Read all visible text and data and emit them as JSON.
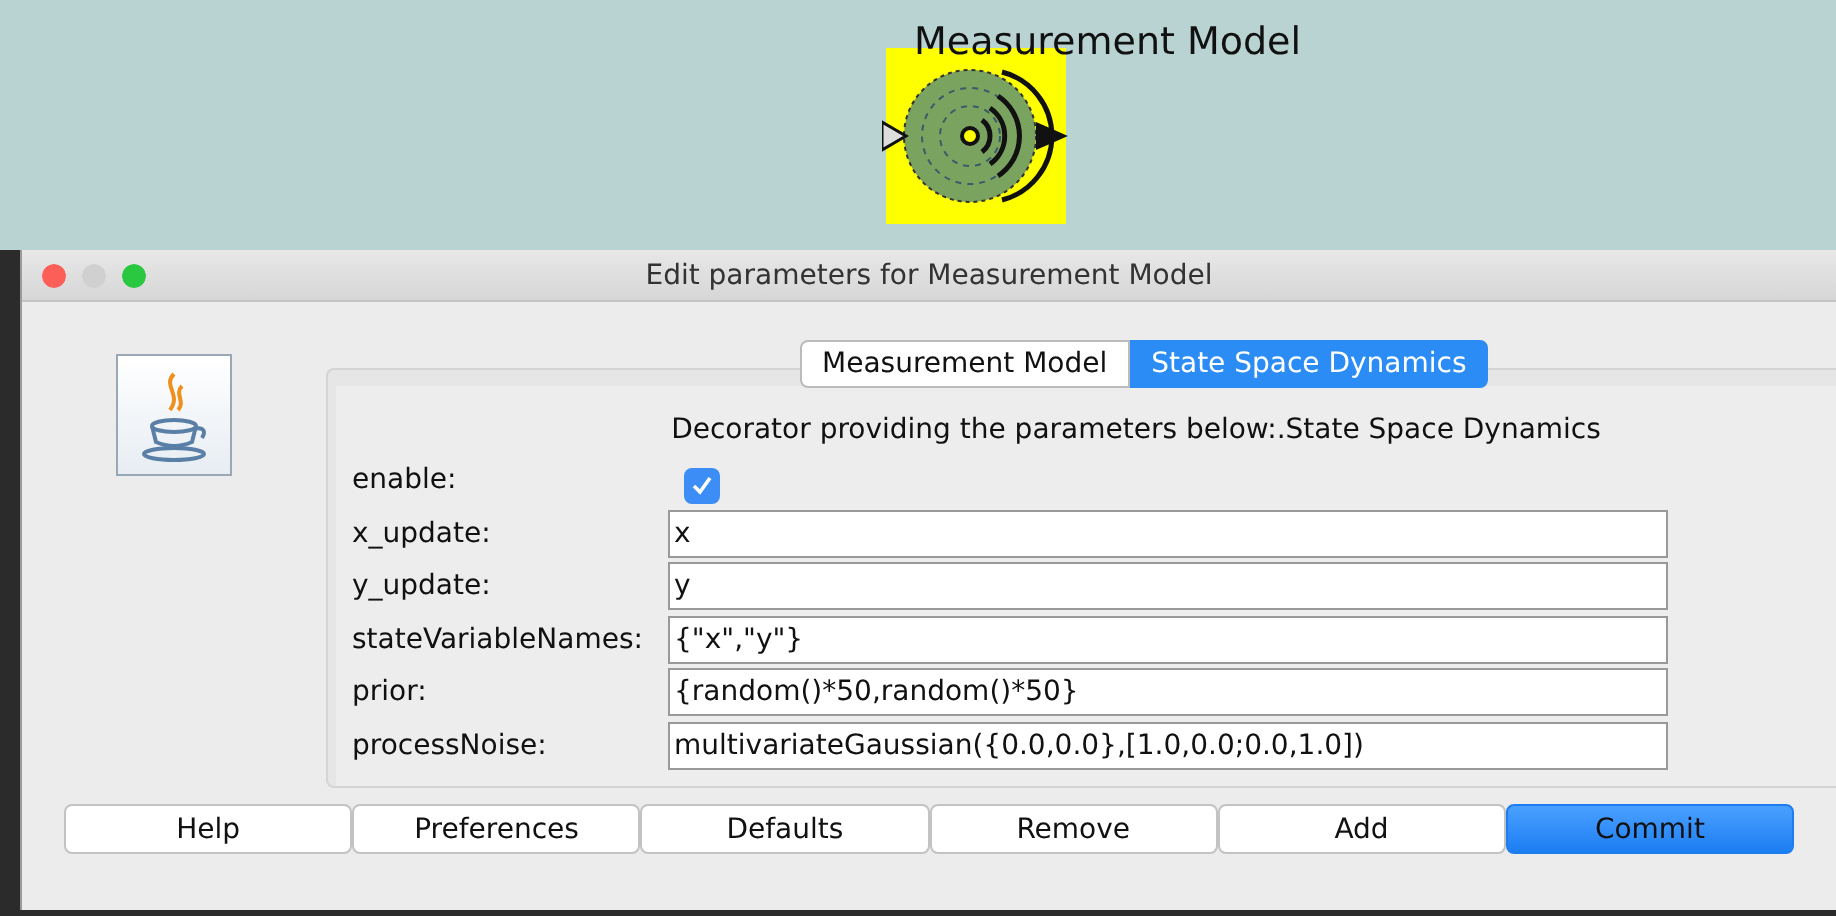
{
  "canvas": {
    "node": {
      "label": "Measurement Model"
    }
  },
  "dialog": {
    "title": "Edit parameters for Measurement Model",
    "tabs": [
      {
        "label": "Measurement Model",
        "selected": false
      },
      {
        "label": "State Space Dynamics",
        "selected": true
      }
    ],
    "description": "Decorator providing the parameters below:.State Space Dynamics",
    "fields": [
      {
        "kind": "checkbox",
        "label": "enable:",
        "checked": true
      },
      {
        "kind": "text",
        "label": "x_update:",
        "value": "x"
      },
      {
        "kind": "text",
        "label": "y_update:",
        "value": "y"
      },
      {
        "kind": "text",
        "label": "stateVariableNames:",
        "value": "{\"x\",\"y\"}"
      },
      {
        "kind": "text",
        "label": "prior:",
        "value": "{random()*50,random()*50}"
      },
      {
        "kind": "text",
        "label": "processNoise:",
        "value": "multivariateGaussian({0.0,0.0},[1.0,0.0;0.0,1.0])"
      }
    ],
    "buttons": [
      {
        "label": "Help",
        "default": false
      },
      {
        "label": "Preferences",
        "default": false
      },
      {
        "label": "Defaults",
        "default": false
      },
      {
        "label": "Remove",
        "default": false
      },
      {
        "label": "Add",
        "default": false
      },
      {
        "label": "Commit",
        "default": true
      }
    ]
  }
}
